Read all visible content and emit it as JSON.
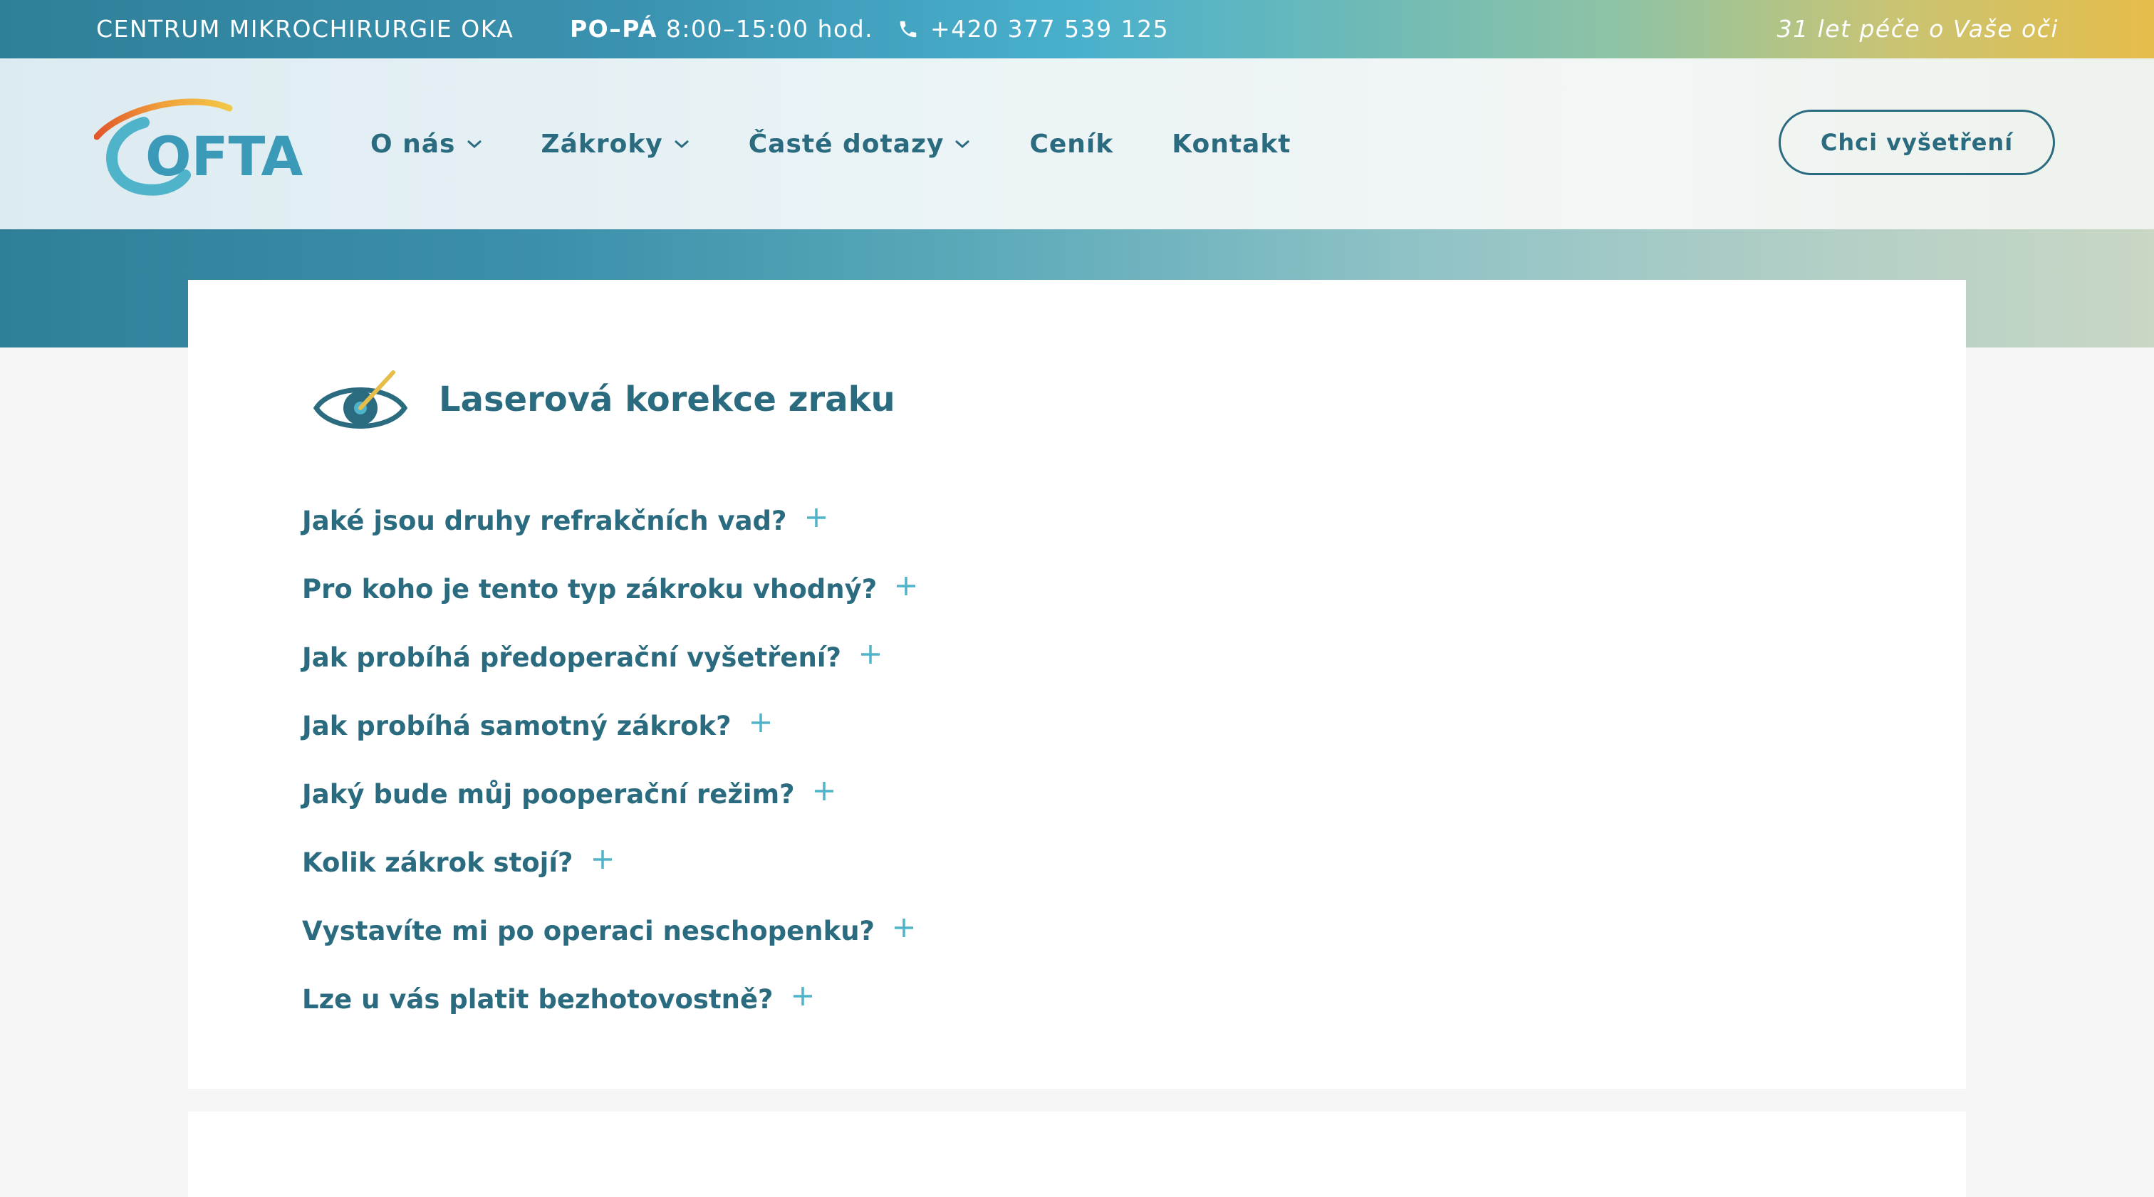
{
  "topbar": {
    "center_name": "CENTRUM MIKROCHIRURGIE OKA",
    "hours_days": "PO–PÁ",
    "hours_time": " 8:00–15:00 hod.",
    "phone": "+420 377 539 125",
    "phone_icon": "phone-icon",
    "slogan": "31 let péče o Vaše oči"
  },
  "header": {
    "logo_text": "OFTA",
    "nav": [
      {
        "label": "O nás",
        "has_dropdown": true
      },
      {
        "label": "Zákroky",
        "has_dropdown": true
      },
      {
        "label": "Časté dotazy",
        "has_dropdown": true
      },
      {
        "label": "Ceník",
        "has_dropdown": false
      },
      {
        "label": "Kontakt",
        "has_dropdown": false
      }
    ],
    "cta_label": "Chci vyšetření"
  },
  "section": {
    "icon": "eye-laser-icon",
    "title": "Laserová korekce zraku",
    "questions": [
      "Jaké jsou druhy refrakčních vad?",
      "Pro koho je tento typ zákroku vhodný?",
      "Jak probíhá předoperační vyšetření?",
      "Jak probíhá samotný zákrok?",
      "Jaký bude můj pooperační režim?",
      "Kolik zákrok stojí?",
      "Vystavíte mi po operaci neschopenku?",
      "Lze u vás platit bezhotovostně?"
    ]
  },
  "colors": {
    "primary": "#2a6b7f",
    "accent_plus": "#4fb3c9",
    "gold": "#e6bd4b"
  }
}
